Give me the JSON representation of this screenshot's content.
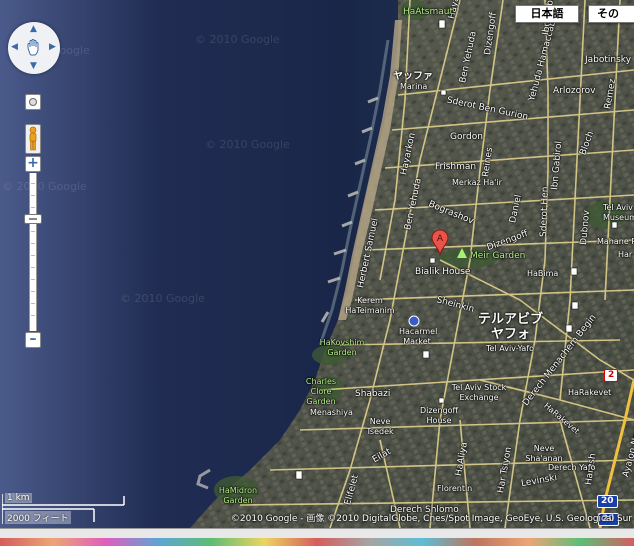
{
  "map_type_buttons": {
    "japanese": "日本語",
    "other": "その"
  },
  "watermarks": [
    "© 2010 Google",
    "© 2010 Google",
    "© 2010 Google",
    "© 2010 Google",
    "© 2010 Google"
  ],
  "labels": {
    "hayarkon_top": "Hayarkon",
    "hatsmaut": "HaAtsmaut",
    "yafo_jp": "ヤッファ",
    "marina": "Marina",
    "ben_yehuda_top": "Ben Yehuda",
    "dizengoff_top": "Dizengoff",
    "yehuda_hamaccabi": "Yehuda Hamaccabi",
    "ibn_gabirol_top": "Ibn Gabirol",
    "jabotinsky": "Jabotinsky",
    "arlozorov": "Arlozorov",
    "remez": "Remez",
    "sderot_ben_gurion": "Sderot Ben Gurion",
    "gordon": "Gordon",
    "bloch": "Bloch",
    "hayarkon_mid": "Hayarkon",
    "frishman": "Frishman",
    "reines": "Reines",
    "ibn_gabirol": "Ibn Gabirol",
    "merkaz_ha": "Merkaz Ha'ir",
    "ben_yehuda_mid": "Ben Yehuda",
    "sderot_hen": "Sderot Hen",
    "tel_aviv_museum": "Tel Aviv Museum",
    "herbert_samuel": "Herbert Samuel",
    "bograshov": "Bograshov",
    "daniel": "Daniel",
    "dizengoff_mid": "Dizengoff",
    "dubnov": "Dubnov",
    "mahane_rabin": "Mahane Rabin",
    "har": "Har",
    "meir_garden": "Meir Garden",
    "bialik_house": "Bialik House",
    "habima": "HaBima",
    "kerem_hateimanim": "Kerem HaTeimanim",
    "sheinkin": "Sheinkin",
    "city_jp": "テルアビブ\nヤフォ",
    "tel_aviv_yafo": "Tel Aviv-Yafo",
    "hacarmel_market": "Hacarmel Market",
    "hakovshim_garden": "HaKovshim Garden",
    "derech_menachem_begin": "Derech Menachem Begin",
    "charles_clore": "Charles Clore Garden",
    "shabazi": "Shabazi",
    "stock_exchange": "Tel Aviv Stock Exchange",
    "harakevet_1": "HaRakevet",
    "menashiya": "Menashiya",
    "neve_tsedek": "Neve Tsedek",
    "dizengoff_house": "Dizengoff House",
    "harakevet_2": "HaRakevet",
    "ayalon_north": "Ayalon North",
    "eilat": "Eilat",
    "haaliya": "HaAliya",
    "neve_shaanan": "Neve Sha'anan",
    "harash": "Harash",
    "derech_yafo": "Derech Yafo",
    "har_tsiyon": "Har Tsiyon",
    "levinski": "Levinski",
    "hamidron_garden": "HaMidron Garden",
    "elifelet": "Elifelet",
    "florentin": "Florentin",
    "derech_shlomo": "Derech Shlomo"
  },
  "shields": {
    "route_2": "2",
    "route_20": "20",
    "route_20b": "20"
  },
  "marker_letter": "A",
  "scale": {
    "km": "1 km",
    "feet": "2000 フィート"
  },
  "copyright": "©2010 Google - 画像 ©2010 DigitalGlobe, Cnes/Spot Image, GeoEye, U.S. Geological Sur"
}
